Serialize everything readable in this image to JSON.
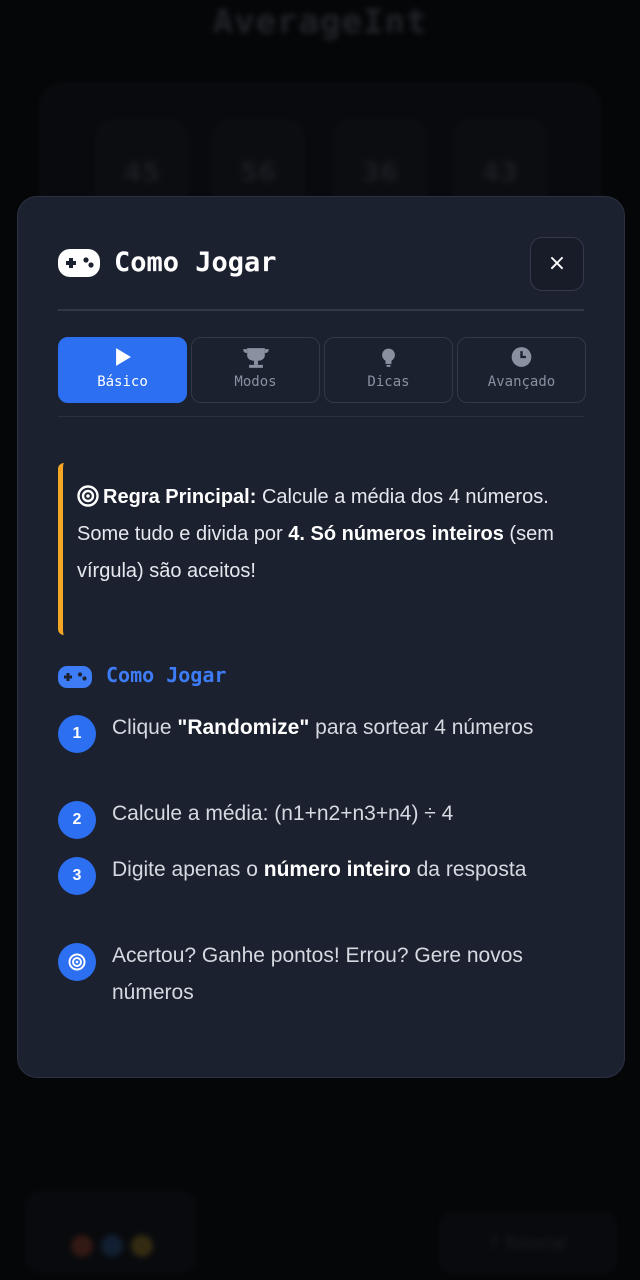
{
  "background": {
    "app_title": "AverageInt",
    "numbers": [
      "45",
      "56",
      "36",
      "43"
    ],
    "tutorial_label": "Tutorial"
  },
  "modal": {
    "title": "Como Jogar",
    "close_label": "×",
    "tabs": [
      {
        "label": "Básico",
        "icon": "play-icon",
        "active": true
      },
      {
        "label": "Modos",
        "icon": "trophy-icon",
        "active": false
      },
      {
        "label": "Dicas",
        "icon": "lightbulb-icon",
        "active": false
      },
      {
        "label": "Avançado",
        "icon": "clock-icon",
        "active": false
      }
    ],
    "rule": {
      "label": "Regra Principal:",
      "text_1": " Calcule a média dos 4 números. Some tudo e divida por ",
      "bold_1": "4. Só números inteiros",
      "text_2": " (sem vírgula) são aceitos!"
    },
    "section_title": "Como Jogar",
    "steps": [
      {
        "badge": "1",
        "pre": "Clique ",
        "bold": "\"Randomize\"",
        "post": " para sortear 4 números"
      },
      {
        "badge": "2",
        "pre": "Calcule a média: (n1+n2+n3+n4) ÷ 4",
        "bold": "",
        "post": ""
      },
      {
        "badge": "3",
        "pre": "Digite apenas o ",
        "bold": "número inteiro",
        "post": " da resposta"
      },
      {
        "badge": "target-icon",
        "pre": "Acertou? Ganhe pontos! Errou? Gere novos números",
        "bold": "",
        "post": ""
      }
    ]
  },
  "colors": {
    "accent": "#2c6ff0",
    "highlight": "#f5a623",
    "modal_bg": "#1c2130"
  }
}
